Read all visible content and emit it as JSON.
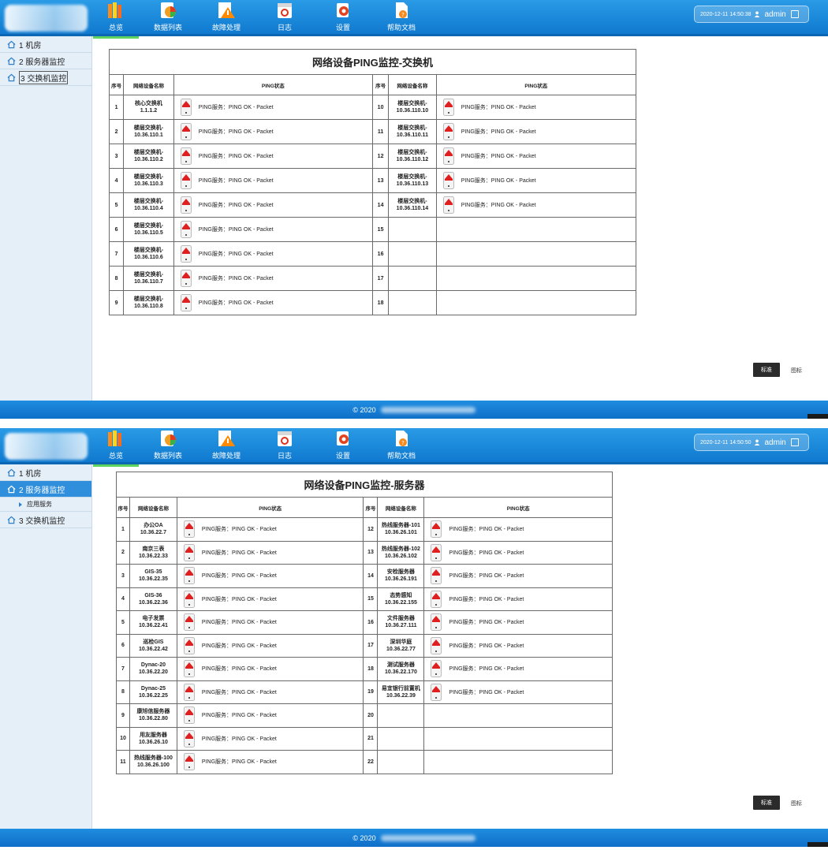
{
  "panels": [
    {
      "nav": [
        {
          "label": "总览",
          "icon": "overview-books-icon"
        },
        {
          "label": "数据列表",
          "icon": "data-list-chart-icon"
        },
        {
          "label": "故障处理",
          "icon": "fault-warning-icon"
        },
        {
          "label": "日志",
          "icon": "log-calendar-icon"
        },
        {
          "label": "设置",
          "icon": "settings-gear-icon"
        },
        {
          "label": "帮助文档",
          "icon": "help-document-icon"
        }
      ],
      "datetime": "2020-12-11 14:50:38",
      "username": "admin",
      "sidebar": [
        {
          "label": "1 机房"
        },
        {
          "label": "2 服务器监控"
        },
        {
          "label": "3 交换机监控"
        }
      ],
      "table": {
        "title": "网络设备PING监控-交换机",
        "headers": {
          "idx": "序号",
          "name": "网络设备名称",
          "status": "PING状态"
        },
        "left": [
          {
            "idx": "1",
            "name1": "核心交换机",
            "name2": "1.1.1.2",
            "status": "PING服务：PING OK - Packet"
          },
          {
            "idx": "2",
            "name1": "楼层交换机-",
            "name2": "10.36.110.1",
            "status": "PING服务：PING OK - Packet"
          },
          {
            "idx": "3",
            "name1": "楼层交换机-",
            "name2": "10.36.110.2",
            "status": "PING服务：PING OK - Packet"
          },
          {
            "idx": "4",
            "name1": "楼层交换机-",
            "name2": "10.36.110.3",
            "status": "PING服务：PING OK - Packet"
          },
          {
            "idx": "5",
            "name1": "楼层交换机-",
            "name2": "10.36.110.4",
            "status": "PING服务：PING OK - Packet"
          },
          {
            "idx": "6",
            "name1": "楼层交换机-",
            "name2": "10.36.110.5",
            "status": "PING服务：PING OK - Packet"
          },
          {
            "idx": "7",
            "name1": "楼层交换机-",
            "name2": "10.36.110.6",
            "status": "PING服务：PING OK - Packet"
          },
          {
            "idx": "8",
            "name1": "楼层交换机-",
            "name2": "10.36.110.7",
            "status": "PING服务：PING OK - Packet"
          },
          {
            "idx": "9",
            "name1": "楼层交换机-",
            "name2": "10.36.110.8",
            "status": "PING服务：PING OK - Packet"
          }
        ],
        "right": [
          {
            "idx": "10",
            "name1": "楼层交换机-",
            "name2": "10.36.110.10",
            "status": "PING服务：PING OK - Packet"
          },
          {
            "idx": "11",
            "name1": "楼层交换机-",
            "name2": "10.36.110.11",
            "status": "PING服务：PING OK - Packet"
          },
          {
            "idx": "12",
            "name1": "楼层交换机-",
            "name2": "10.36.110.12",
            "status": "PING服务：PING OK - Packet"
          },
          {
            "idx": "13",
            "name1": "楼层交换机-",
            "name2": "10.36.110.13",
            "status": "PING服务：PING OK - Packet"
          },
          {
            "idx": "14",
            "name1": "楼层交换机-",
            "name2": "10.36.110.14",
            "status": "PING服务：PING OK - Packet"
          },
          {
            "idx": "15",
            "name1": "",
            "name2": "",
            "status": ""
          },
          {
            "idx": "16",
            "name1": "",
            "name2": "",
            "status": ""
          },
          {
            "idx": "17",
            "name1": "",
            "name2": "",
            "status": ""
          },
          {
            "idx": "18",
            "name1": "",
            "name2": "",
            "status": ""
          }
        ]
      },
      "btn_standard": "标准",
      "btn_icon": "图标",
      "footer": "© 2020"
    },
    {
      "nav": [
        {
          "label": "总览",
          "icon": "overview-books-icon"
        },
        {
          "label": "数据列表",
          "icon": "data-list-chart-icon"
        },
        {
          "label": "故障处理",
          "icon": "fault-warning-icon"
        },
        {
          "label": "日志",
          "icon": "log-calendar-icon"
        },
        {
          "label": "设置",
          "icon": "settings-gear-icon"
        },
        {
          "label": "帮助文档",
          "icon": "help-document-icon"
        }
      ],
      "datetime": "2020-12-11 14:50:50",
      "username": "admin",
      "sidebar": [
        {
          "label": "1 机房"
        },
        {
          "label": "2 服务器监控"
        },
        {
          "label": "应用服务"
        },
        {
          "label": "3 交换机监控"
        }
      ],
      "table": {
        "title": "网络设备PING监控-服务器",
        "headers": {
          "idx": "序号",
          "name": "网络设备名称",
          "status": "PING状态"
        },
        "left": [
          {
            "idx": "1",
            "name1": "办公OA",
            "name2": "10.36.22.7",
            "status": "PING服务：PING OK - Packet"
          },
          {
            "idx": "2",
            "name1": "南京三表",
            "name2": "10.36.22.33",
            "status": "PING服务：PING OK - Packet"
          },
          {
            "idx": "3",
            "name1": "GIS-35",
            "name2": "10.36.22.35",
            "status": "PING服务：PING OK - Packet"
          },
          {
            "idx": "4",
            "name1": "GIS-36",
            "name2": "10.36.22.36",
            "status": "PING服务：PING OK - Packet"
          },
          {
            "idx": "5",
            "name1": "电子发票",
            "name2": "10.36.22.41",
            "status": "PING服务：PING OK - Packet"
          },
          {
            "idx": "6",
            "name1": "巡检GIS",
            "name2": "10.36.22.42",
            "status": "PING服务：PING OK - Packet"
          },
          {
            "idx": "7",
            "name1": "Dynac-20",
            "name2": "10.36.22.20",
            "status": "PING服务：PING OK - Packet"
          },
          {
            "idx": "8",
            "name1": "Dynac-25",
            "name2": "10.36.22.25",
            "status": "PING服务：PING OK - Packet"
          },
          {
            "idx": "9",
            "name1": "康旭信服务器",
            "name2": "10.36.22.80",
            "status": "PING服务：PING OK - Packet"
          },
          {
            "idx": "10",
            "name1": "用友服务器",
            "name2": "10.36.26.10",
            "status": "PING服务：PING OK - Packet"
          },
          {
            "idx": "11",
            "name1": "热线服务器-100",
            "name2": "10.36.26.100",
            "status": "PING服务：PING OK - Packet"
          }
        ],
        "right": [
          {
            "idx": "12",
            "name1": "热线服务器-101",
            "name2": "10.36.26.101",
            "status": "PING服务：PING OK - Packet"
          },
          {
            "idx": "13",
            "name1": "热线服务器-102",
            "name2": "10.36.26.102",
            "status": "PING服务：PING OK - Packet"
          },
          {
            "idx": "14",
            "name1": "安检服务器",
            "name2": "10.36.26.191",
            "status": "PING服务：PING OK - Packet"
          },
          {
            "idx": "15",
            "name1": "态势感知",
            "name2": "10.36.22.155",
            "status": "PING服务：PING OK - Packet"
          },
          {
            "idx": "16",
            "name1": "文件服务器",
            "name2": "10.36.27.111",
            "status": "PING服务：PING OK - Packet"
          },
          {
            "idx": "17",
            "name1": "深圳华庭",
            "name2": "10.36.22.77",
            "status": "PING服务：PING OK - Packet"
          },
          {
            "idx": "18",
            "name1": "测试服务器",
            "name2": "10.36.22.170",
            "status": "PING服务：PING OK - Packet"
          },
          {
            "idx": "19",
            "name1": "易宜银行前置机",
            "name2": "10.36.22.39",
            "status": "PING服务：PING OK - Packet"
          },
          {
            "idx": "20",
            "name1": "",
            "name2": "",
            "status": ""
          },
          {
            "idx": "21",
            "name1": "",
            "name2": "",
            "status": ""
          },
          {
            "idx": "22",
            "name1": "",
            "name2": "",
            "status": ""
          }
        ]
      },
      "btn_standard": "标准",
      "btn_icon": "图标",
      "footer": "© 2020"
    }
  ]
}
